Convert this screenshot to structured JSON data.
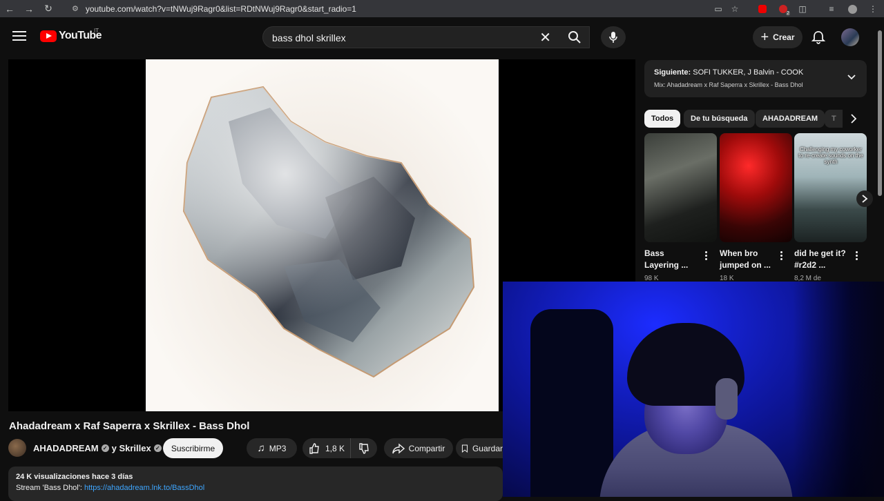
{
  "browser": {
    "url": "youtube.com/watch?v=tNWuj9Ragr0&list=RDtNWuj9Ragr0&start_radio=1",
    "ext_badge": "2"
  },
  "header": {
    "logo_text": "YouTube",
    "logo_country": "IT",
    "search_value": "bass dhol skrillex",
    "create_label": "Crear"
  },
  "video": {
    "title": "Ahadadream x Raf Saperra x Skrillex - Bass Dhol",
    "channel": "AHADADREAM",
    "channel_suffix": "y Skrillex",
    "subscribe_label": "Suscribirme",
    "mp3_label": "MP3",
    "likes": "1,8 K",
    "share_label": "Compartir",
    "save_label": "Guardar",
    "views_date": "24 K visualizaciones  hace 3 días",
    "desc_prefix": "Stream 'Bass Dhol':",
    "desc_link": "https://ahadadream.lnk.to/BassDhol"
  },
  "mix": {
    "next_label": "Siguiente:",
    "next_title": "SOFI TUKKER, J Balvin - COOK",
    "mix_title": "Mix: Ahadadream x Raf Saperra x Skrillex - Bass Dhol"
  },
  "chips": [
    "Todos",
    "De tu búsqueda",
    "AHADADREAM",
    "T"
  ],
  "shorts": [
    {
      "title": "Bass Layering ...",
      "views": "98 K"
    },
    {
      "title": "When bro jumped on ...",
      "views": "18 K"
    },
    {
      "title": "did he get it? #r2d2 ...",
      "views": "8,2 M de",
      "overlay": "Challenging my coworker to re-create sounds on the synth"
    }
  ],
  "colors": {
    "accent": "#ff0000",
    "link": "#3ea6ff",
    "bg": "#0f0f0f"
  }
}
